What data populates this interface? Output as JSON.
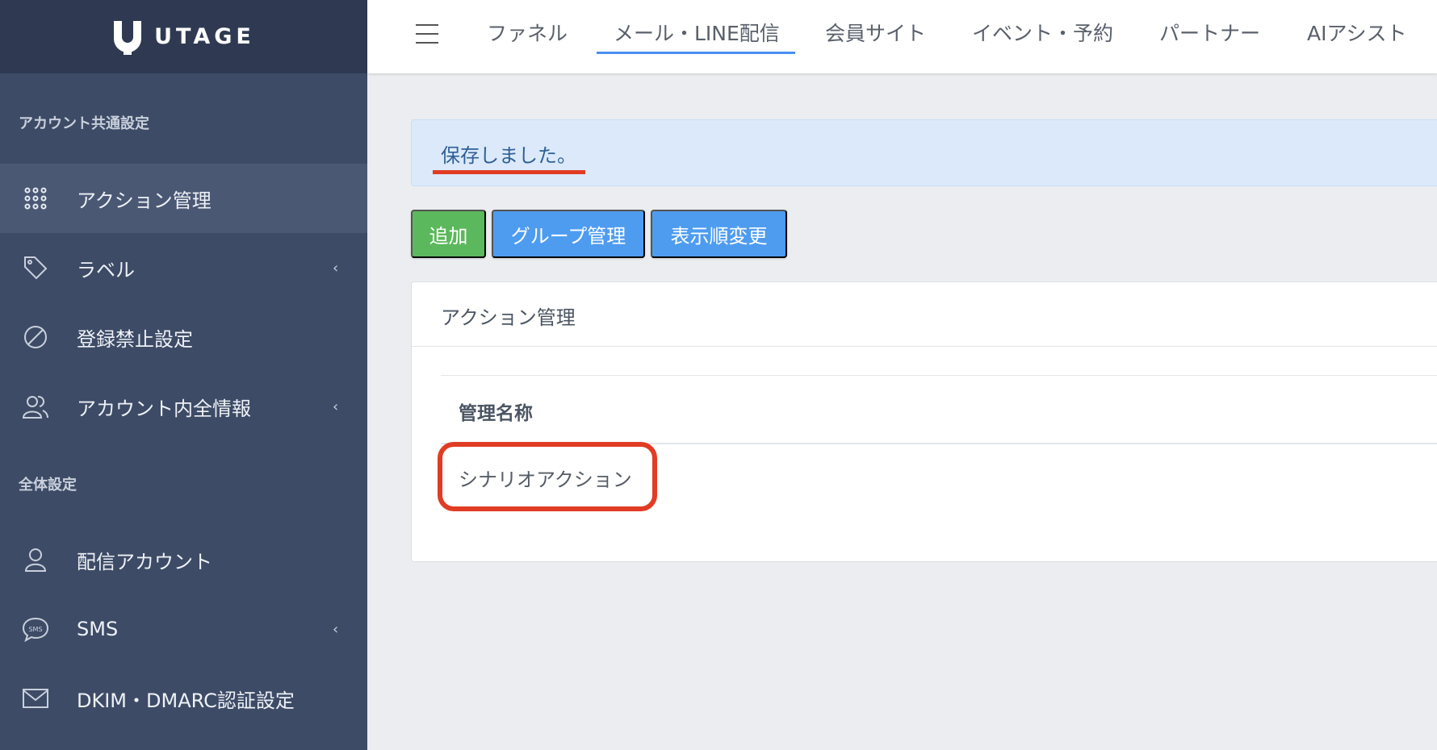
{
  "brand": {
    "name": "UTAGE"
  },
  "sidebar": {
    "section1_title": "アカウント共通設定",
    "section2_title": "全体設定",
    "items": [
      {
        "label": "アクション管理",
        "icon": "grid-dots-icon",
        "active": true,
        "chevron": false
      },
      {
        "label": "ラベル",
        "icon": "tag-icon",
        "active": false,
        "chevron": true
      },
      {
        "label": "登録禁止設定",
        "icon": "ban-icon",
        "active": false,
        "chevron": false
      },
      {
        "label": "アカウント内全情報",
        "icon": "users-icon",
        "active": false,
        "chevron": true
      },
      {
        "label": "配信アカウント",
        "icon": "user-icon",
        "active": false,
        "chevron": false
      },
      {
        "label": "SMS",
        "icon": "sms-bubble-icon",
        "active": false,
        "chevron": true
      },
      {
        "label": "DKIM・DMARC認証設定",
        "icon": "envelope-icon",
        "active": false,
        "chevron": false
      }
    ],
    "chevron_glyph": "‹"
  },
  "topnav": {
    "tabs": [
      {
        "label": "ファネル"
      },
      {
        "label": "メール・LINE配信",
        "active": true
      },
      {
        "label": "会員サイト"
      },
      {
        "label": "イベント・予約"
      },
      {
        "label": "パートナー"
      },
      {
        "label": "AIアシスト"
      }
    ]
  },
  "alert": {
    "message": "保存しました。"
  },
  "toolbar": {
    "add_label": "追加",
    "group_label": "グループ管理",
    "order_label": "表示順変更"
  },
  "card": {
    "title": "アクション管理",
    "column_header": "管理名称",
    "rows": [
      {
        "name": "シナリオアクション"
      }
    ]
  },
  "colors": {
    "sidebar_bg": "#3d4b66",
    "brand_bg": "#2f3a52",
    "accent_blue": "#4e9cf0",
    "success_green": "#5cb85c",
    "annotation_red": "#e13c24"
  }
}
